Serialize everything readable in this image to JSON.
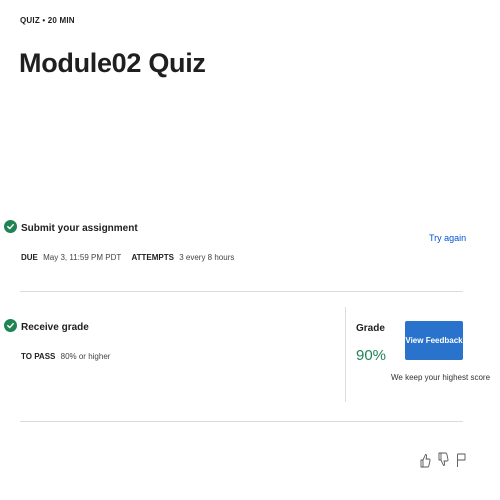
{
  "header": {
    "eyebrow": "QUIZ • 20 MIN",
    "title": "Module02 Quiz"
  },
  "submit": {
    "title": "Submit your assignment",
    "due_label": "DUE",
    "due_value": "May 3, 11:59 PM PDT",
    "attempts_label": "ATTEMPTS",
    "attempts_value": "3 every 8 hours",
    "try_again": "Try again"
  },
  "receive": {
    "title": "Receive grade",
    "to_pass_label": "TO PASS",
    "to_pass_value": "80% or higher",
    "grade_label": "Grade",
    "grade_value": "90%",
    "view_feedback": "View Feedback",
    "note": "We keep your highest score"
  },
  "colors": {
    "accent": "#0056d2",
    "button": "#2a73cc",
    "success": "#1f8354"
  },
  "icons": [
    "check-circle-icon",
    "thumbs-up-icon",
    "thumbs-down-icon",
    "flag-icon"
  ]
}
